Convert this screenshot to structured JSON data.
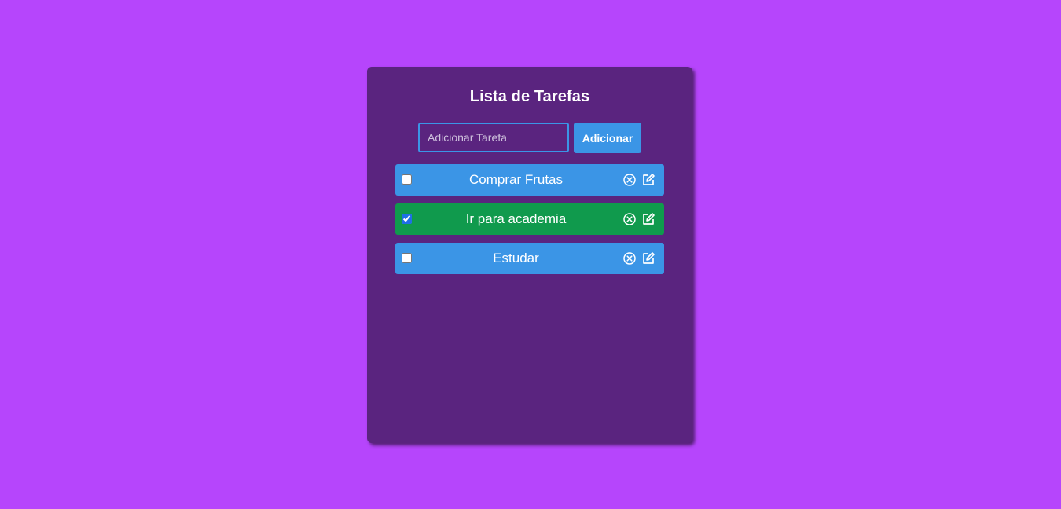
{
  "app": {
    "title": "Lista de Tarefas"
  },
  "form": {
    "input_value": "",
    "input_placeholder": "Adicionar Tarefa",
    "add_label": "Adicionar"
  },
  "tasks": [
    {
      "label": "Comprar Frutas",
      "completed": false
    },
    {
      "label": "Ir para academia",
      "completed": true
    },
    {
      "label": "Estudar",
      "completed": false
    }
  ],
  "icons": {
    "remove": "circle-x-icon",
    "edit": "pencil-square-icon"
  },
  "colors": {
    "background": "#b645fc",
    "card": "#5a247f",
    "accent": "#3b95e6",
    "completed": "#109a4d",
    "text": "#ffffff"
  }
}
